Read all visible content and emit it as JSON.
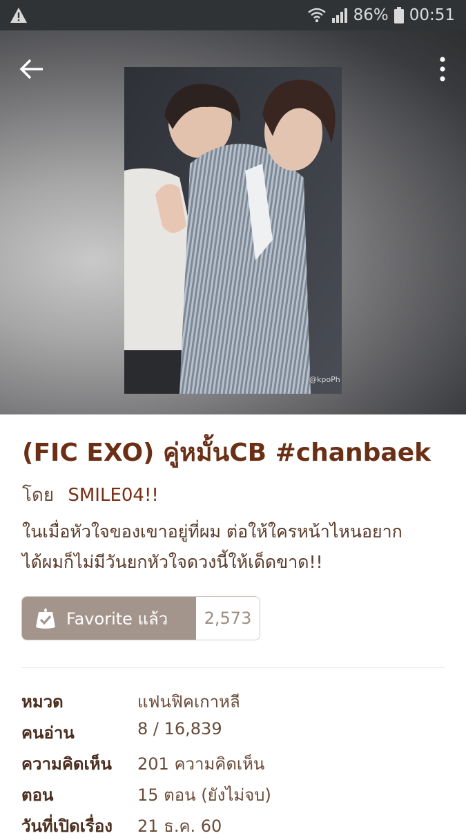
{
  "status_bar": {
    "battery": "86%",
    "time": "00:51"
  },
  "story": {
    "title": "(FIC EXO) คู่หมั้นCB #chanbaek",
    "by_label": "โดย",
    "author": "SMILE04!!",
    "description_line1": "ในเมื่อหัวใจของเขาอยู่ที่ผม ต่อให้ใครหน้าไหนอยาก",
    "description_line2": "ได้ผมก็ไม่มีวันยกหัวใจดวงนี้ให้เด็ดขาด!!",
    "favorite_label": "Favorite แล้ว",
    "favorite_count": "2,573",
    "cover_watermark": "@kpoPh"
  },
  "info": [
    {
      "label": "หมวด",
      "value": "แฟนฟิคเกาหลี"
    },
    {
      "label": "คนอ่าน",
      "value": "8 / 16,839"
    },
    {
      "label": "ความคิดเห็น",
      "value": "201 ความคิดเห็น"
    },
    {
      "label": "ตอน",
      "value": "15 ตอน (ยังไม่จบ)"
    },
    {
      "label": "วันที่เปิดเรื่อง",
      "value": "21 ธ.ค. 60"
    }
  ],
  "colors": {
    "title": "#6b2f15",
    "favorite_button": "#a3958b"
  }
}
